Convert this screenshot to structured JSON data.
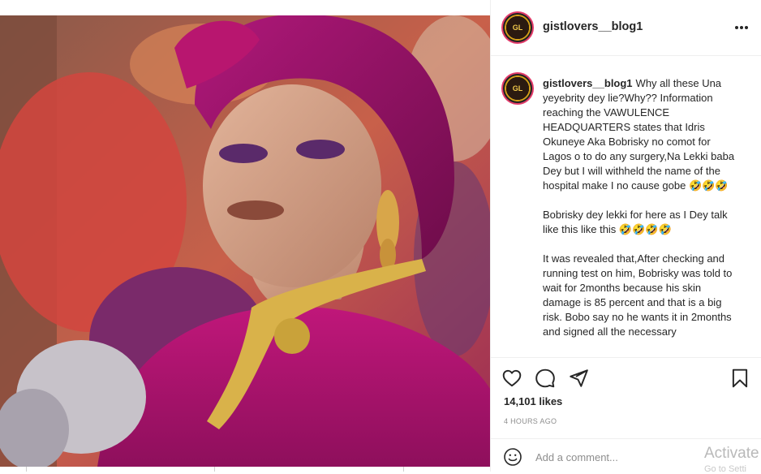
{
  "post": {
    "username": "gistlovers__blog1",
    "more_icon": "more-horizontal-icon",
    "image_alt_subject": "portrait-photo"
  },
  "caption": {
    "username": "gistlovers__blog1",
    "paragraph_1": "Why all these Una yeyebrity dey lie?Why?? Information reaching the VAWULENCE HEADQUARTERS states that Idris Okuneye Aka Bobrisky no comot for Lagos o to do any surgery,Na Lekki baba Dey but I will withheld the name of the hospital make I no cause gobe 🤣🤣🤣",
    "paragraph_2": "Bobrisky dey lekki for here as I Dey talk like this like this 🤣🤣🤣🤣",
    "paragraph_3": "It was revealed that,After checking and running test on him, Bobrisky was told to wait for 2months because his skin damage is 85 percent and that is a big risk. Bobo say no he wants it in 2months and signed all the necessary"
  },
  "actions": {
    "icons": [
      "heart-icon",
      "comment-icon",
      "share-icon",
      "bookmark-icon"
    ],
    "likes": "14,101 likes",
    "timestamp": "4 HOURS AGO"
  },
  "comment": {
    "placeholder": "Add a comment..."
  },
  "overlay": {
    "watermark": "Activate",
    "watermark_sub": "Go to Setti"
  },
  "colors": {
    "text": "#262626",
    "muted": "#8e8e8e",
    "border": "#efefef",
    "photo_dominant": "#b0186e"
  }
}
